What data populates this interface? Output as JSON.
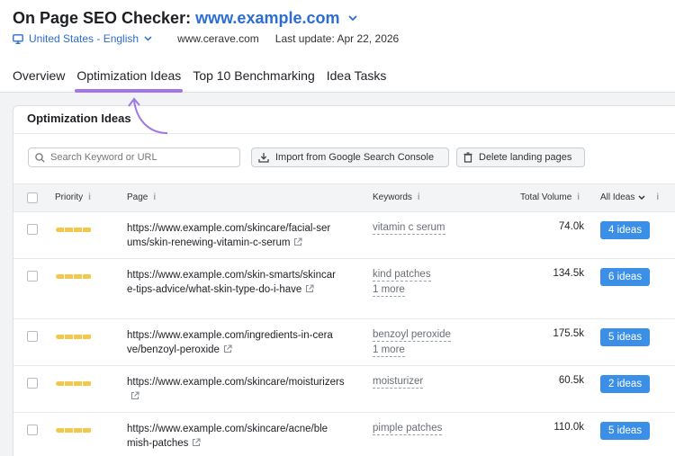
{
  "header": {
    "title": "On Page SEO Checker:",
    "domain": "www.example.com",
    "location": "United States - English",
    "site": "www.cerave.com",
    "last_update": "Last update: Apr 22, 2026"
  },
  "tabs": [
    {
      "label": "Overview"
    },
    {
      "label": "Optimization Ideas"
    },
    {
      "label": "Top 10 Benchmarking"
    },
    {
      "label": "Idea Tasks"
    }
  ],
  "card": {
    "title": "Optimization Ideas",
    "search_placeholder": "Search Keyword or URL",
    "import_label": "Import from Google Search Console",
    "delete_label": "Delete landing pages"
  },
  "columns": {
    "priority": "Priority",
    "page": "Page",
    "keywords": "Keywords",
    "volume": "Total Volume",
    "ideas": "All Ideas"
  },
  "rows": [
    {
      "page": "https://www.example.com/skincare/facial-serums/skin-renewing-vitamin-c-serum",
      "keyword": "vitamin c serum",
      "more": "",
      "volume": "74.0k",
      "ideas": "4 ideas"
    },
    {
      "page": "https://www.example.com/skin-smarts/skincare-tips-advice/what-skin-type-do-i-have",
      "keyword": "kind patches",
      "more": "1 more",
      "volume": "134.5k",
      "ideas": "6 ideas"
    },
    {
      "page": "https://www.example.com/ingredients-in-cerave/benzoyl-peroxide",
      "keyword": "benzoyl peroxide",
      "more": "1 more",
      "volume": "175.5k",
      "ideas": "5 ideas"
    },
    {
      "page": "https://www.example.com/skincare/moisturizers",
      "keyword": "moisturizer",
      "more": "",
      "volume": "60.5k",
      "ideas": "2 ideas"
    },
    {
      "page": "https://www.example.com/skincare/acne/blemish-patches",
      "keyword": "pimple patches",
      "more": "",
      "volume": "110.0k",
      "ideas": "5 ideas"
    }
  ],
  "colors": {
    "accent_blue": "#2c6dd2",
    "tab_underline": "#a076e8",
    "priority_bar": "#f2c94c",
    "ideas_button": "#3b8fe6"
  }
}
